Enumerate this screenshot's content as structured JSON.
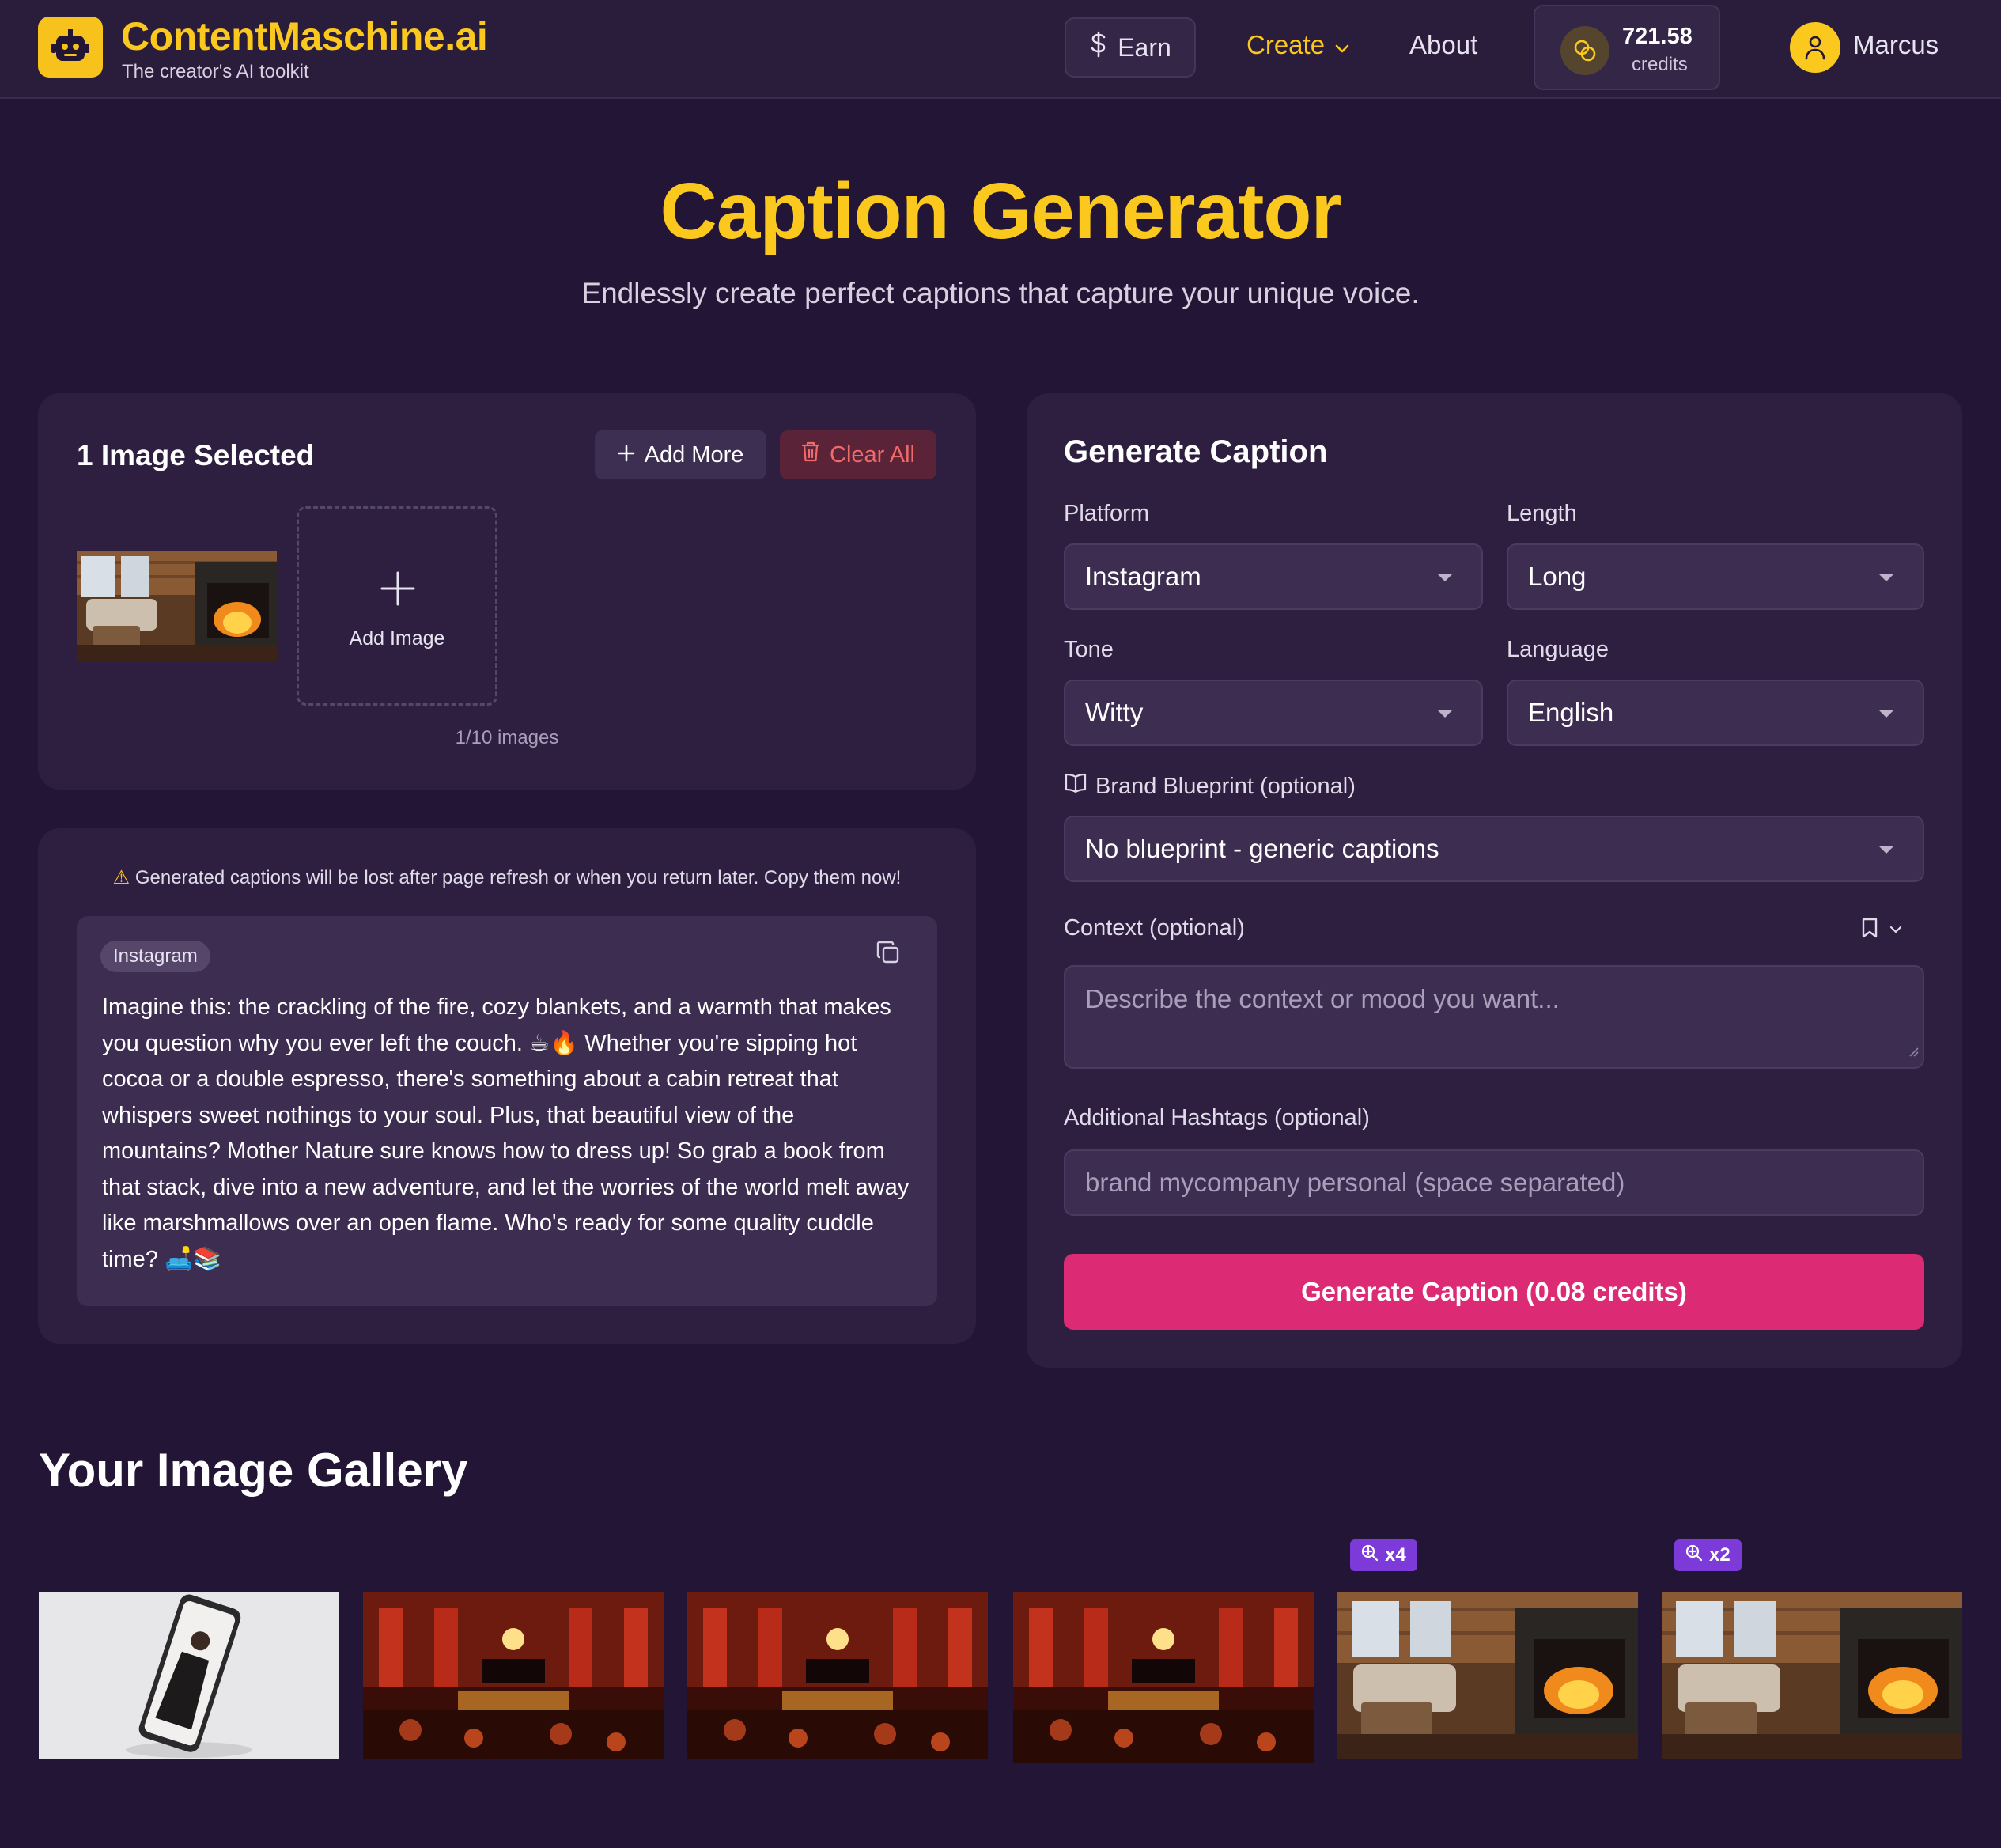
{
  "app": {
    "brand": "ContentMaschine.ai",
    "tagline": "The creator's AI toolkit",
    "accent_color": "#fbc81d",
    "primary_color": "#dc2a74"
  },
  "nav": {
    "earn_label": "Earn",
    "create_label": "Create",
    "about_label": "About",
    "credits_value": "721.58",
    "credits_label": "credits",
    "user_name": "Marcus"
  },
  "hero": {
    "title": "Caption Generator",
    "subtitle": "Endlessly create perfect captions that capture your unique voice."
  },
  "selection": {
    "title": "1 Image Selected",
    "add_more_label": "Add More",
    "clear_all_label": "Clear All",
    "add_image_label": "Add Image",
    "count_label": "1/10 images"
  },
  "output": {
    "warning": "Generated captions will be lost after page refresh or when you return later. Copy them now!",
    "platform_badge": "Instagram",
    "caption": "Imagine this: the crackling of the fire, cozy blankets, and a warmth that makes you question why you ever left the couch. ☕🔥 Whether you're sipping hot cocoa or a double espresso, there's something about a cabin retreat that whispers sweet nothings to your soul. Plus, that beautiful view of the mountains? Mother Nature sure knows how to dress up! So grab a book from that stack, dive into a new adventure, and let the worries of the world melt away like marshmallows over an open flame. Who's ready for some quality cuddle time? 🛋️📚"
  },
  "form": {
    "title": "Generate Caption",
    "platform_label": "Platform",
    "platform_value": "Instagram",
    "length_label": "Length",
    "length_value": "Long",
    "tone_label": "Tone",
    "tone_value": "Witty",
    "language_label": "Language",
    "language_value": "English",
    "blueprint_label": "Brand Blueprint (optional)",
    "blueprint_value": "No blueprint - generic captions",
    "context_label": "Context (optional)",
    "context_placeholder": "Describe the context or mood you want...",
    "hashtags_label": "Additional Hashtags (optional)",
    "hashtags_placeholder": "brand mycompany personal (space separated)",
    "generate_label": "Generate Caption (0.08 credits)"
  },
  "gallery": {
    "title": "Your Image Gallery",
    "items": [
      {
        "subject": "woman-on-phone-screen",
        "badge": ""
      },
      {
        "subject": "red-concert-hall",
        "badge": ""
      },
      {
        "subject": "red-concert-hall",
        "badge": ""
      },
      {
        "subject": "red-concert-hall",
        "badge": ""
      },
      {
        "subject": "cabin-fireplace",
        "badge": "x4"
      },
      {
        "subject": "cabin-fireplace",
        "badge": "x2"
      }
    ]
  }
}
